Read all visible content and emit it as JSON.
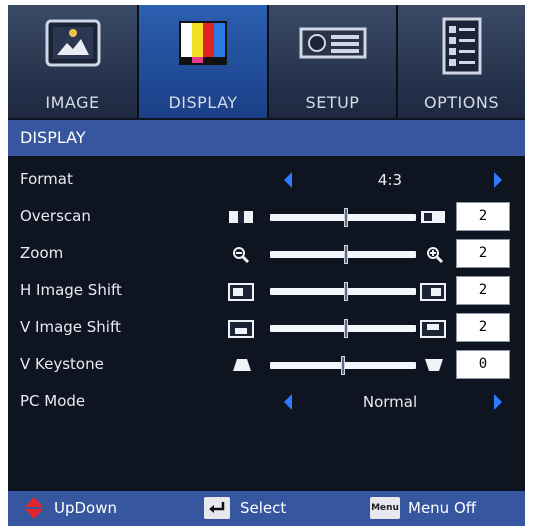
{
  "tabs": [
    {
      "label": "IMAGE",
      "icon": "image-icon"
    },
    {
      "label": "DISPLAY",
      "icon": "color-bars-icon",
      "active": true
    },
    {
      "label": "SETUP",
      "icon": "projector-setup-icon"
    },
    {
      "label": "OPTIONS",
      "icon": "checklist-icon"
    }
  ],
  "section_title": "DISPLAY",
  "rows": {
    "format": {
      "label": "Format",
      "value": "4:3"
    },
    "overscan": {
      "label": "Overscan",
      "value": "2",
      "level": 0.52
    },
    "zoom": {
      "label": "Zoom",
      "value": "2",
      "level": 0.52
    },
    "h_image_shift": {
      "label": "H Image Shift",
      "value": "2",
      "level": 0.52
    },
    "v_image_shift": {
      "label": "V Image Shift",
      "value": "2",
      "level": 0.52
    },
    "v_keystone": {
      "label": "V Keystone",
      "value": "0",
      "level": 0.5
    },
    "pc_mode": {
      "label": "PC Mode",
      "value": "Normal"
    }
  },
  "footer": {
    "updown_label": "UpDown",
    "select_label": "Select",
    "menu_key": "Menu",
    "menu_off_label": "Menu Off"
  },
  "colors": {
    "accent": "#2d7bff",
    "header": "#3656a0",
    "active_tab": "#2b5fb0"
  }
}
